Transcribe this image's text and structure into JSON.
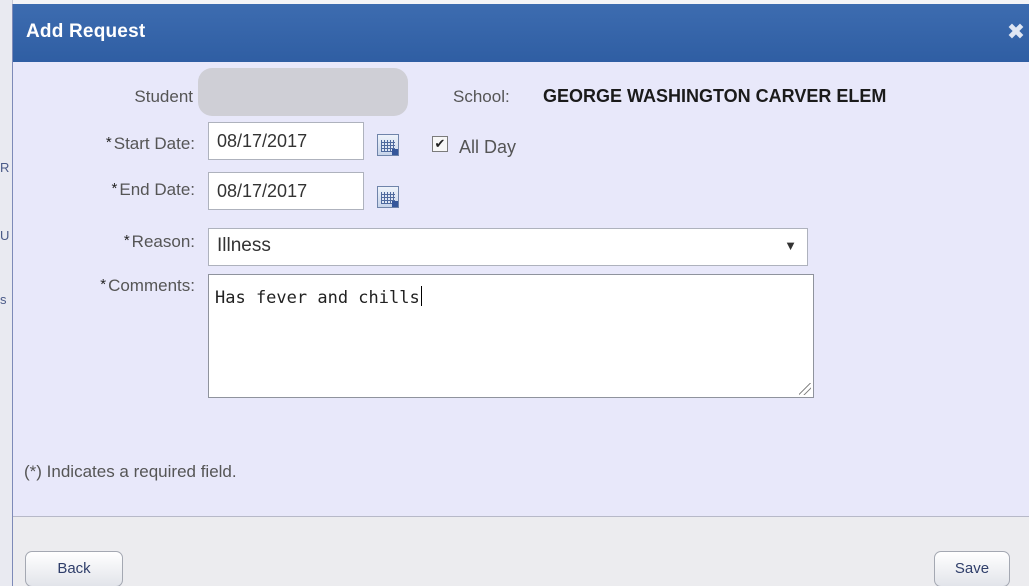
{
  "dialog": {
    "title": "Add Request",
    "close_icon": "close-icon"
  },
  "form": {
    "student_label": "Student",
    "school_label": "School:",
    "school_value": "GEORGE WASHINGTON CARVER ELEM",
    "required_mark": "*",
    "start_date_label": "Start Date:",
    "start_date_value": "08/17/2017",
    "all_day_label": "All Day",
    "all_day_checked": "✔",
    "end_date_label": "End Date:",
    "end_date_value": "08/17/2017",
    "reason_label": "Reason:",
    "reason_value": "Illness",
    "comments_label": "Comments:",
    "comments_value": "Has fever and chills",
    "calendar_icon": "calendar-icon"
  },
  "note": {
    "required_text": "(*) Indicates a required field."
  },
  "footer": {
    "back_label": "Back",
    "save_label": "Save"
  },
  "colors": {
    "titlebar": "#3d6cb0",
    "dialog_bg": "#e8e8fa"
  }
}
